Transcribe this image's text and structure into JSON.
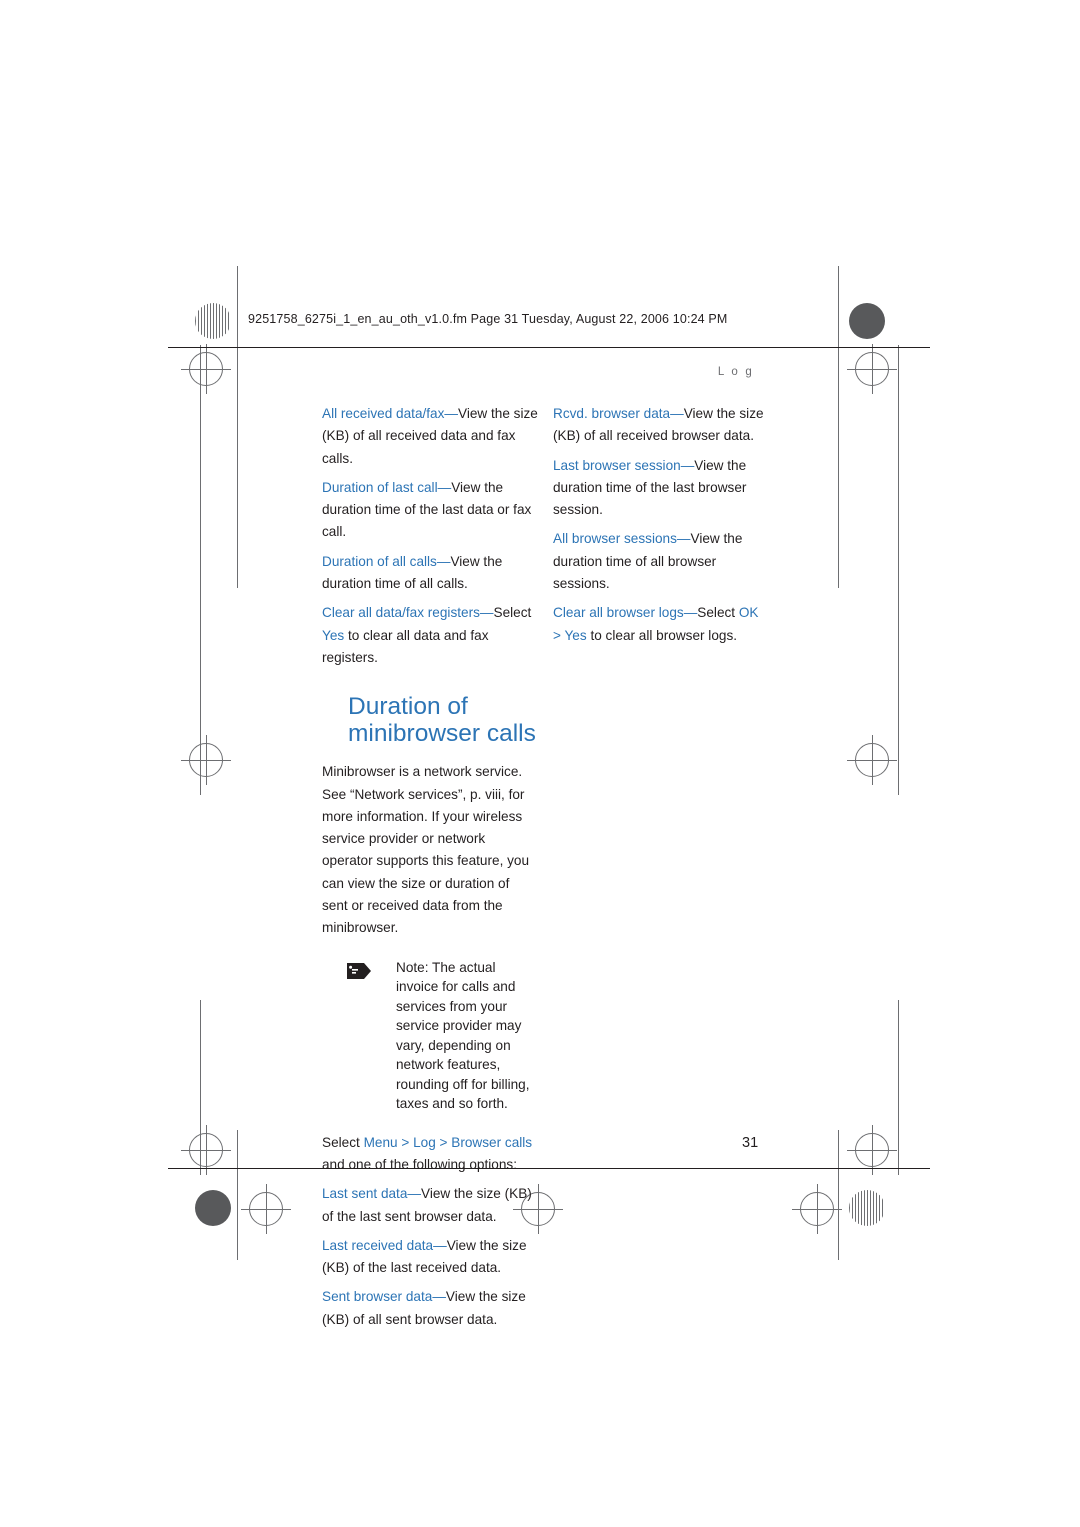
{
  "page": {
    "filestamp": "9251758_6275i_1_en_au_oth_v1.0.fm  Page 31  Tuesday, August 22, 2006  10:24 PM",
    "running_head": "L o g",
    "page_number": "31"
  },
  "left_column": {
    "entries": [
      {
        "term": "All received data/fax",
        "sep": "—",
        "body": "View the size (KB) of all received data and fax calls."
      },
      {
        "term": "Duration of last call",
        "sep": "—",
        "body": "View the duration time of the last data or fax call."
      },
      {
        "term": "Duration of all calls",
        "sep": "—",
        "body": "View the duration time of all calls."
      },
      {
        "term": "Clear all data/fax registers",
        "sep": "—",
        "body_pre": "Select ",
        "body_ui": "Yes",
        "body_post": " to clear all data and fax registers."
      }
    ],
    "heading_line1": "Duration of",
    "heading_line2": "minibrowser calls",
    "intro": "Minibrowser is a network service. See “Network services”, p. viii, for more information. If your wireless service provider or network operator supports this feature, you can view the size or duration of sent or received data from the minibrowser.",
    "note": {
      "label": "Note:",
      "text": " The actual invoice for calls and services from your service provider may vary, depending on network features, rounding off for billing, taxes and so forth.",
      "icon": "note-hand-icon"
    },
    "select_line": {
      "pre": "Select ",
      "menu": "Menu",
      "arrow1": " > ",
      "log": "Log",
      "arrow2": " > ",
      "browser_calls": "Browser calls",
      "post": " and one of the following options:"
    },
    "entries2": [
      {
        "term": "Last sent data",
        "sep": "—",
        "body": "View the size (KB) of the last sent browser data."
      },
      {
        "term": "Last received data",
        "sep": "—",
        "body": "View the size (KB) of the last received data."
      },
      {
        "term": "Sent browser data",
        "sep": "—",
        "body": "View the size (KB) of all sent browser data."
      }
    ]
  },
  "right_column": {
    "entries": [
      {
        "term": "Rcvd. browser data",
        "sep": "—",
        "body": "View the size (KB) of all received browser data."
      },
      {
        "term": "Last browser session",
        "sep": "—",
        "body": "View the duration time of the last browser session."
      },
      {
        "term": "All browser sessions",
        "sep": "—",
        "body": "View the duration time of all browser sessions."
      },
      {
        "term": "Clear all browser logs",
        "sep": "—",
        "body_pre": "Select ",
        "body_ui1": "OK",
        "body_arrow": " > ",
        "body_ui2": "Yes",
        "body_post": " to clear all browser logs."
      }
    ]
  },
  "colors": {
    "accent": "#2c74b5",
    "text": "#231f20",
    "marks": "#6d6e71"
  }
}
